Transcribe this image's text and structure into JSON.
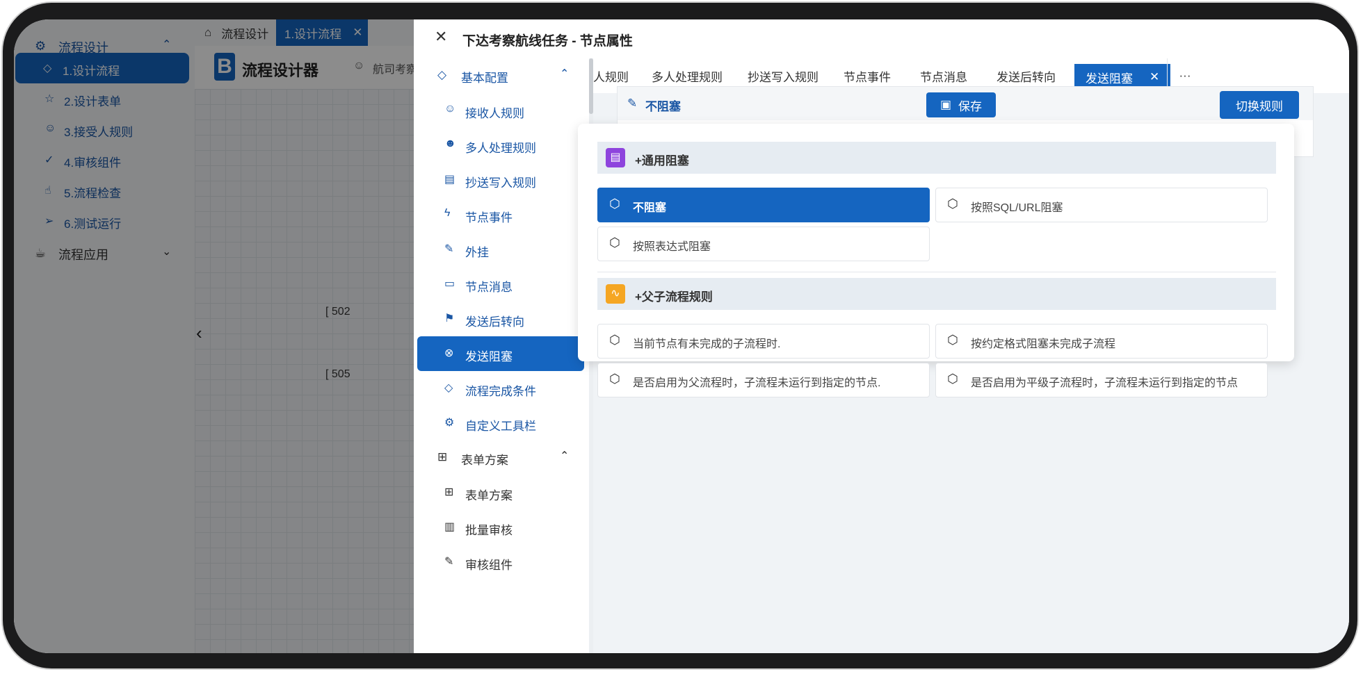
{
  "sidebar": {
    "group_design": "流程设计",
    "items": [
      {
        "label": "1.设计流程",
        "icon": "droplet-icon",
        "glyph": "◇",
        "active": true
      },
      {
        "label": "2.设计表单",
        "icon": "star-icon",
        "glyph": "☆",
        "active": false
      },
      {
        "label": "3.接受人规则",
        "icon": "users-icon",
        "glyph": "☺",
        "active": false
      },
      {
        "label": "4.审核组件",
        "icon": "check-circle-icon",
        "glyph": "✓",
        "active": false
      },
      {
        "label": "5.流程检查",
        "icon": "thumb-icon",
        "glyph": "☝",
        "active": false
      },
      {
        "label": "6.测试运行",
        "icon": "send-icon",
        "glyph": "➢",
        "active": false
      }
    ],
    "group_app": "流程应用"
  },
  "topbar": {
    "tab_home": "流程设计",
    "tab_active": "1.设计流程"
  },
  "designer": {
    "logo_letter": "B",
    "title": "流程设计器",
    "flow_name": "航司考察航",
    "node_label_1": "[ 502",
    "node_label_2": "[ 505"
  },
  "drawer": {
    "title": "下达考察航线任务 - 节点属性",
    "menu": {
      "group_basic": "基本配置",
      "items": [
        {
          "label": "接收人规则",
          "icon": "user-icon",
          "glyph": "☺",
          "active": false
        },
        {
          "label": "多人处理规则",
          "icon": "users-icon",
          "glyph": "☻",
          "active": false
        },
        {
          "label": "抄送写入规则",
          "icon": "book-icon",
          "glyph": "▤",
          "active": false
        },
        {
          "label": "节点事件",
          "icon": "bolt-icon",
          "glyph": "ϟ",
          "active": false
        },
        {
          "label": "外挂",
          "icon": "plug-icon",
          "glyph": "✎",
          "active": false
        },
        {
          "label": "节点消息",
          "icon": "message-icon",
          "glyph": "▭",
          "active": false
        },
        {
          "label": "发送后转向",
          "icon": "signpost-icon",
          "glyph": "⚑",
          "active": false
        },
        {
          "label": "发送阻塞",
          "icon": "block-icon",
          "glyph": "⊗",
          "active": true
        },
        {
          "label": "流程完成条件",
          "icon": "droplet-icon",
          "glyph": "◇",
          "active": false
        },
        {
          "label": "自定义工具栏",
          "icon": "gear-icon",
          "glyph": "⚙",
          "active": false
        }
      ],
      "group_form": "表单方案",
      "form_items": [
        {
          "label": "表单方案",
          "icon": "grid-icon",
          "glyph": "⊞"
        },
        {
          "label": "批量审核",
          "icon": "batch-icon",
          "glyph": "▥"
        },
        {
          "label": "审核组件",
          "icon": "edit-icon",
          "glyph": "✎"
        }
      ]
    },
    "tabs": [
      {
        "label": "人规则",
        "active": false
      },
      {
        "label": "多人处理规则",
        "active": false
      },
      {
        "label": "抄送写入规则",
        "active": false
      },
      {
        "label": "节点事件",
        "active": false
      },
      {
        "label": "节点消息",
        "active": false
      },
      {
        "label": "发送后转向",
        "active": false
      },
      {
        "label": "发送阻塞",
        "active": true
      }
    ],
    "more": "···",
    "card": {
      "title": "不阻塞",
      "save": "保存",
      "switch": "切换规则"
    },
    "popup": {
      "section1": "+通用阻塞",
      "section1_options": [
        "不阻塞",
        "按照SQL/URL阻塞",
        "按照表达式阻塞"
      ],
      "section2": "+父子流程规则",
      "section2_options": [
        "当前节点有未完成的子流程时.",
        "按约定格式阻塞未完成子流程",
        "是否启用为父流程时，子流程未运行到指定的节点.",
        "是否启用为平级子流程时，子流程未运行到指定的节点"
      ]
    }
  },
  "colors": {
    "primary": "#1565c0",
    "section_bg": "#e6ecf2",
    "badge_purple": "#8e44dd",
    "badge_orange": "#f5a623"
  }
}
